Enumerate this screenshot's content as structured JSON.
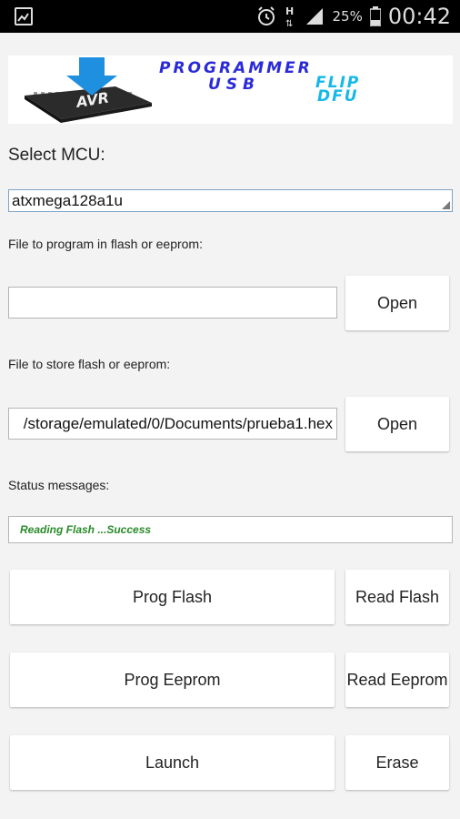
{
  "statusbar": {
    "battery_percent": "25%",
    "time": "00:42",
    "icons": [
      "image-thumbnail-icon",
      "alarm-icon",
      "hplus-network-icon",
      "signal-icon",
      "battery-icon"
    ]
  },
  "banner": {
    "line1": "PROGRAMMER",
    "usb": "USB",
    "flip": "FLIP",
    "dfu": "DFU",
    "chip_text": "AVR"
  },
  "mcu": {
    "label": "Select MCU:",
    "selected": "atxmega128a1u"
  },
  "flash_in": {
    "label": "File to program in flash or eeprom:",
    "value": "",
    "open_label": "Open"
  },
  "flash_out": {
    "label": "File to store flash or eeprom:",
    "value": "/storage/emulated/0/Documents/prueba1.hex",
    "open_label": "Open"
  },
  "status": {
    "label": "Status messages:",
    "message": "Reading Flash ...Success"
  },
  "actions": {
    "prog_flash": "Prog Flash",
    "read_flash": "Read Flash",
    "prog_eeprom": "Prog Eeprom",
    "read_eeprom": "Read Eeprom",
    "launch": "Launch",
    "erase": "Erase"
  },
  "colors": {
    "banner_blue": "#2a2ad8",
    "banner_cyan": "#15b8e8",
    "status_green": "#2a8a2a",
    "spinner_border": "#7fa3c7"
  }
}
